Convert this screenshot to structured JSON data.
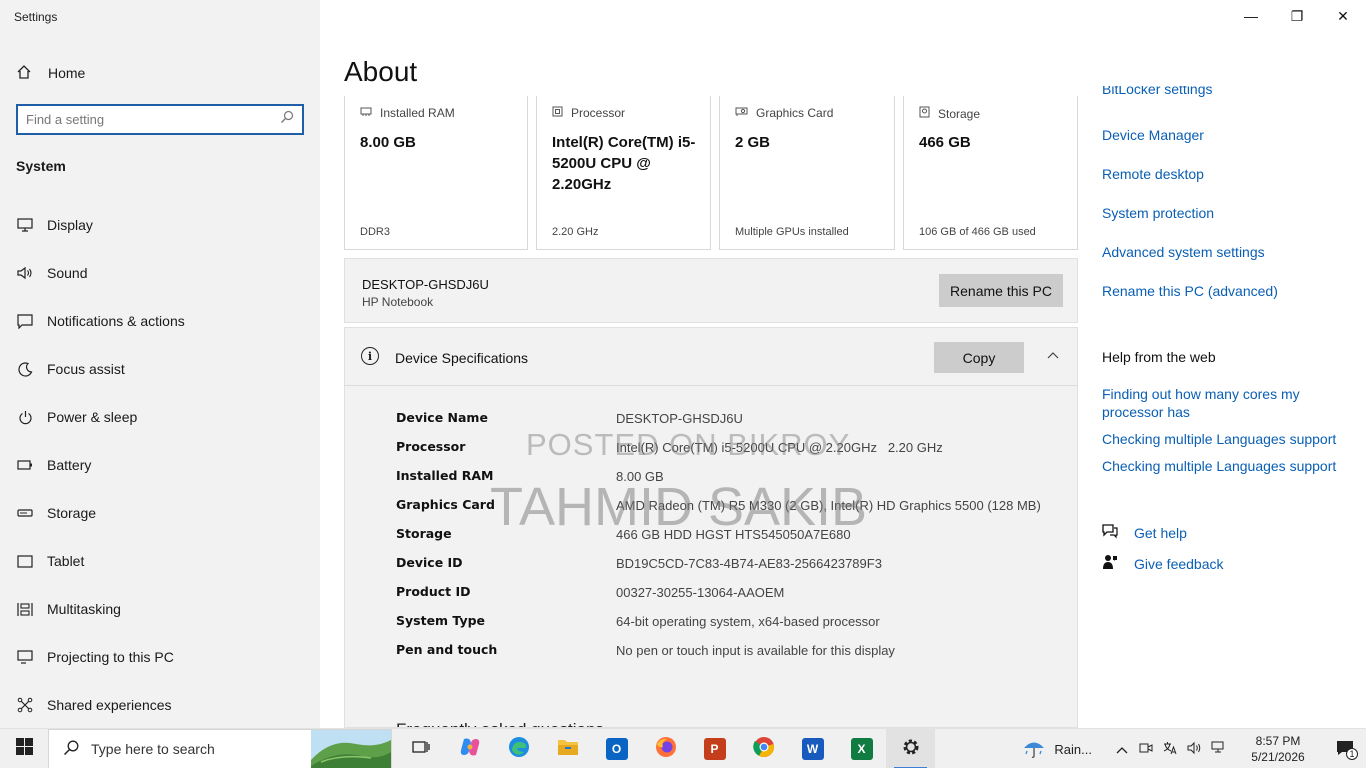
{
  "app": {
    "title": "Settings"
  },
  "window_controls": {
    "minimize": "—",
    "maximize": "❐",
    "close": "✕"
  },
  "nav": {
    "home": "Home",
    "search_placeholder": "Find a setting",
    "section": "System",
    "items": [
      {
        "label": "Display",
        "icon": "display-icon"
      },
      {
        "label": "Sound",
        "icon": "sound-icon"
      },
      {
        "label": "Notifications & actions",
        "icon": "notifications-icon"
      },
      {
        "label": "Focus assist",
        "icon": "focus-assist-icon"
      },
      {
        "label": "Power & sleep",
        "icon": "power-icon"
      },
      {
        "label": "Battery",
        "icon": "battery-icon"
      },
      {
        "label": "Storage",
        "icon": "storage-icon"
      },
      {
        "label": "Tablet",
        "icon": "tablet-icon"
      },
      {
        "label": "Multitasking",
        "icon": "multitasking-icon"
      },
      {
        "label": "Projecting to this PC",
        "icon": "projecting-icon"
      },
      {
        "label": "Shared experiences",
        "icon": "shared-experiences-icon"
      }
    ]
  },
  "main": {
    "title": "About",
    "cards": [
      {
        "label": "Installed RAM",
        "value": "8.00 GB",
        "sub": "DDR3",
        "icon": "ram-icon"
      },
      {
        "label": "Processor",
        "value": "Intel(R) Core(TM) i5-5200U CPU @ 2.20GHz",
        "sub": "2.20 GHz",
        "icon": "processor-icon"
      },
      {
        "label": "Graphics Card",
        "value": "2 GB",
        "sub": "Multiple GPUs installed",
        "icon": "graphics-card-icon"
      },
      {
        "label": "Storage",
        "value": "466 GB",
        "sub": "106 GB of 466 GB used",
        "icon": "storage-drive-icon"
      }
    ],
    "pc": {
      "name": "DESKTOP-GHSDJ6U",
      "model": "HP Notebook",
      "rename_label": "Rename this PC"
    },
    "specs": {
      "title": "Device Specifications",
      "copy_label": "Copy",
      "rows": [
        {
          "key": "Device Name",
          "value": "DESKTOP-GHSDJ6U"
        },
        {
          "key": "Processor",
          "value": "Intel(R) Core(TM) i5-5200U CPU @ 2.20GHz   2.20 GHz"
        },
        {
          "key": "Installed RAM",
          "value": "8.00 GB"
        },
        {
          "key": "Graphics Card",
          "value": "AMD Radeon (TM) R5 M330 (2 GB), Intel(R) HD Graphics 5500 (128 MB)"
        },
        {
          "key": "Storage",
          "value": "466 GB HDD HGST HTS545050A7E680"
        },
        {
          "key": "Device ID",
          "value": "BD19C5CD-7C83-4B74-AE83-2566423789F3"
        },
        {
          "key": "Product ID",
          "value": "00327-30255-13064-AAOEM"
        },
        {
          "key": "System Type",
          "value": "64-bit operating system, x64-based processor"
        },
        {
          "key": "Pen and touch",
          "value": "No pen or touch input is available for this display"
        }
      ],
      "faq_title": "Frequently asked questions"
    },
    "watermark": {
      "line1": "POSTED ON BIKROY",
      "line2": "TAHMID SAKIB"
    }
  },
  "related": {
    "links": [
      "BitLocker settings",
      "Device Manager",
      "Remote desktop",
      "System protection",
      "Advanced system settings",
      "Rename this PC (advanced)"
    ],
    "help_title": "Help from the web",
    "help_links": [
      "Finding out how many cores my processor has",
      "Checking multiple Languages support",
      "Checking multiple Languages support"
    ],
    "get_help": "Get help",
    "give_feedback": "Give feedback"
  },
  "taskbar": {
    "search_placeholder": "Type here to search",
    "weather": "Rain...",
    "time": "8:57 PM",
    "date": "5/21/2026",
    "notification_count": "1",
    "colors": {
      "accent": "#3a7fd8"
    }
  }
}
